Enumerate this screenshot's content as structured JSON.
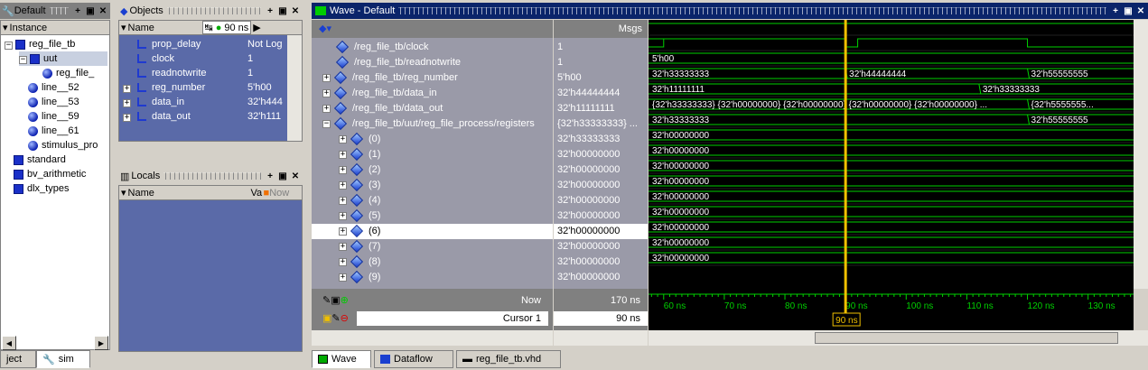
{
  "instance_pane": {
    "title": "Default",
    "column": "Instance",
    "items": [
      {
        "label": "reg_file_tb",
        "icon": "square"
      },
      {
        "label": "uut",
        "icon": "square"
      },
      {
        "label": "reg_file_",
        "icon": "ball"
      },
      {
        "label": "line__52",
        "icon": "ball"
      },
      {
        "label": "line__53",
        "icon": "ball"
      },
      {
        "label": "line__59",
        "icon": "ball"
      },
      {
        "label": "line__61",
        "icon": "ball"
      },
      {
        "label": "stimulus_pro",
        "icon": "ball"
      },
      {
        "label": "standard",
        "icon": "square"
      },
      {
        "label": "bv_arithmetic",
        "icon": "square"
      },
      {
        "label": "dlx_types",
        "icon": "square"
      }
    ]
  },
  "objects_pane": {
    "title": "Objects",
    "col_name": "Name",
    "time_value": "90",
    "time_unit": "ns",
    "rows": [
      {
        "name": "prop_delay",
        "value": "Not Log"
      },
      {
        "name": "clock",
        "value": "1"
      },
      {
        "name": "readnotwrite",
        "value": "1"
      },
      {
        "name": "reg_number",
        "value": "5'h00"
      },
      {
        "name": "data_in",
        "value": "32'h444"
      },
      {
        "name": "data_out",
        "value": "32'h111"
      }
    ]
  },
  "locals_pane": {
    "title": "Locals",
    "col_name": "Name",
    "col_va": "Va",
    "col_now": "Now"
  },
  "wave": {
    "title": "Wave - Default",
    "msgs_header": "Msgs",
    "signals": [
      {
        "name": "/reg_file_tb/clock",
        "value": "1"
      },
      {
        "name": "/reg_file_tb/readnotwrite",
        "value": "1"
      },
      {
        "name": "/reg_file_tb/reg_number",
        "value": "5'h00"
      },
      {
        "name": "/reg_file_tb/data_in",
        "value": "32'h44444444"
      },
      {
        "name": "/reg_file_tb/data_out",
        "value": "32'h11111111"
      },
      {
        "name": "/reg_file_tb/uut/reg_file_process/registers",
        "value": "{32'h33333333} ..."
      },
      {
        "name": "(0)",
        "value": "32'h33333333"
      },
      {
        "name": "(1)",
        "value": "32'h00000000"
      },
      {
        "name": "(2)",
        "value": "32'h00000000"
      },
      {
        "name": "(3)",
        "value": "32'h00000000"
      },
      {
        "name": "(4)",
        "value": "32'h00000000"
      },
      {
        "name": "(5)",
        "value": "32'h00000000"
      },
      {
        "name": "(6)",
        "value": "32'h00000000"
      },
      {
        "name": "(7)",
        "value": "32'h00000000"
      },
      {
        "name": "(8)",
        "value": "32'h00000000"
      },
      {
        "name": "(9)",
        "value": "32'h00000000"
      }
    ],
    "wave_labels": {
      "reg_number": "5'h00",
      "data_in": [
        "32'h33333333",
        "32'h44444444",
        "32'h55555555"
      ],
      "data_out": [
        "32'h11111111",
        "32'h33333333"
      ],
      "registers": [
        "{32'h33333333} {32'h00000000} {32'h00000000} {32'h00000000} {32'h00000000} ...",
        "{32'h5555555..."
      ],
      "reg0": [
        "32'h33333333",
        "32'h55555555"
      ],
      "zeros": "32'h00000000"
    },
    "now_label": "Now",
    "now_value": "170 ns",
    "cursor_label": "Cursor 1",
    "cursor_value": "90 ns",
    "cursor_tag": "90 ns",
    "ticks": [
      "60 ns",
      "70 ns",
      "80 ns",
      "90 ns",
      "100 ns",
      "110 ns",
      "120 ns",
      "130 ns"
    ]
  },
  "tabs": {
    "bottom_left": [
      "ject",
      "sim"
    ],
    "bottom_wave": [
      "Wave",
      "Dataflow",
      "reg_file_tb.vhd"
    ]
  },
  "colors": {
    "wave_bg": "#000000",
    "trace": "#00d000",
    "cursor": "#f0c000",
    "title_active": "#0a246a"
  }
}
